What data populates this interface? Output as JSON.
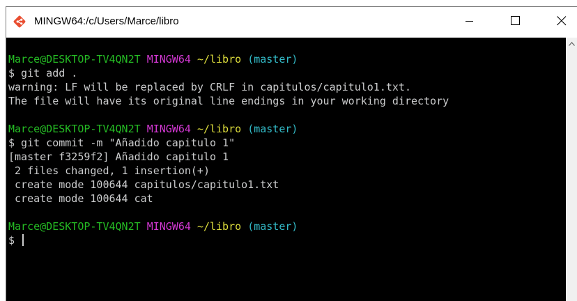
{
  "window": {
    "title": "MINGW64:/c/Users/Marce/libro"
  },
  "icons": {
    "app": "git-icon",
    "minimize": "minimize-icon",
    "maximize": "maximize-icon",
    "close": "close-icon",
    "scroll_up": "chevron-up-icon"
  },
  "colors": {
    "terminal_background": "#000000",
    "user_host": "#25bc24",
    "shell_name": "#d338d3",
    "path": "#dcdc3c",
    "branch": "#33bbc8",
    "text": "#cbcccd",
    "git_icon": "#e94e31"
  },
  "terminal": {
    "prompt1": {
      "user_host": "Marce@DESKTOP-TV4QN2T",
      "shell": "MINGW64",
      "path": "~/libro",
      "branch": "(master)"
    },
    "command1": "$ git add .",
    "output1": [
      "warning: LF will be replaced by CRLF in capitulos/capitulo1.txt.",
      "The file will have its original line endings in your working directory"
    ],
    "prompt2": {
      "user_host": "Marce@DESKTOP-TV4QN2T",
      "shell": "MINGW64",
      "path": "~/libro",
      "branch": "(master)"
    },
    "command2": "$ git commit -m \"Añadido capitulo 1\"",
    "output2": [
      "[master f3259f2] Añadido capitulo 1",
      " 2 files changed, 1 insertion(+)",
      " create mode 100644 capitulos/capitulo1.txt",
      " create mode 100644 cat"
    ],
    "prompt3": {
      "user_host": "Marce@DESKTOP-TV4QN2T",
      "shell": "MINGW64",
      "path": "~/libro",
      "branch": "(master)"
    },
    "input_prompt": "$"
  }
}
